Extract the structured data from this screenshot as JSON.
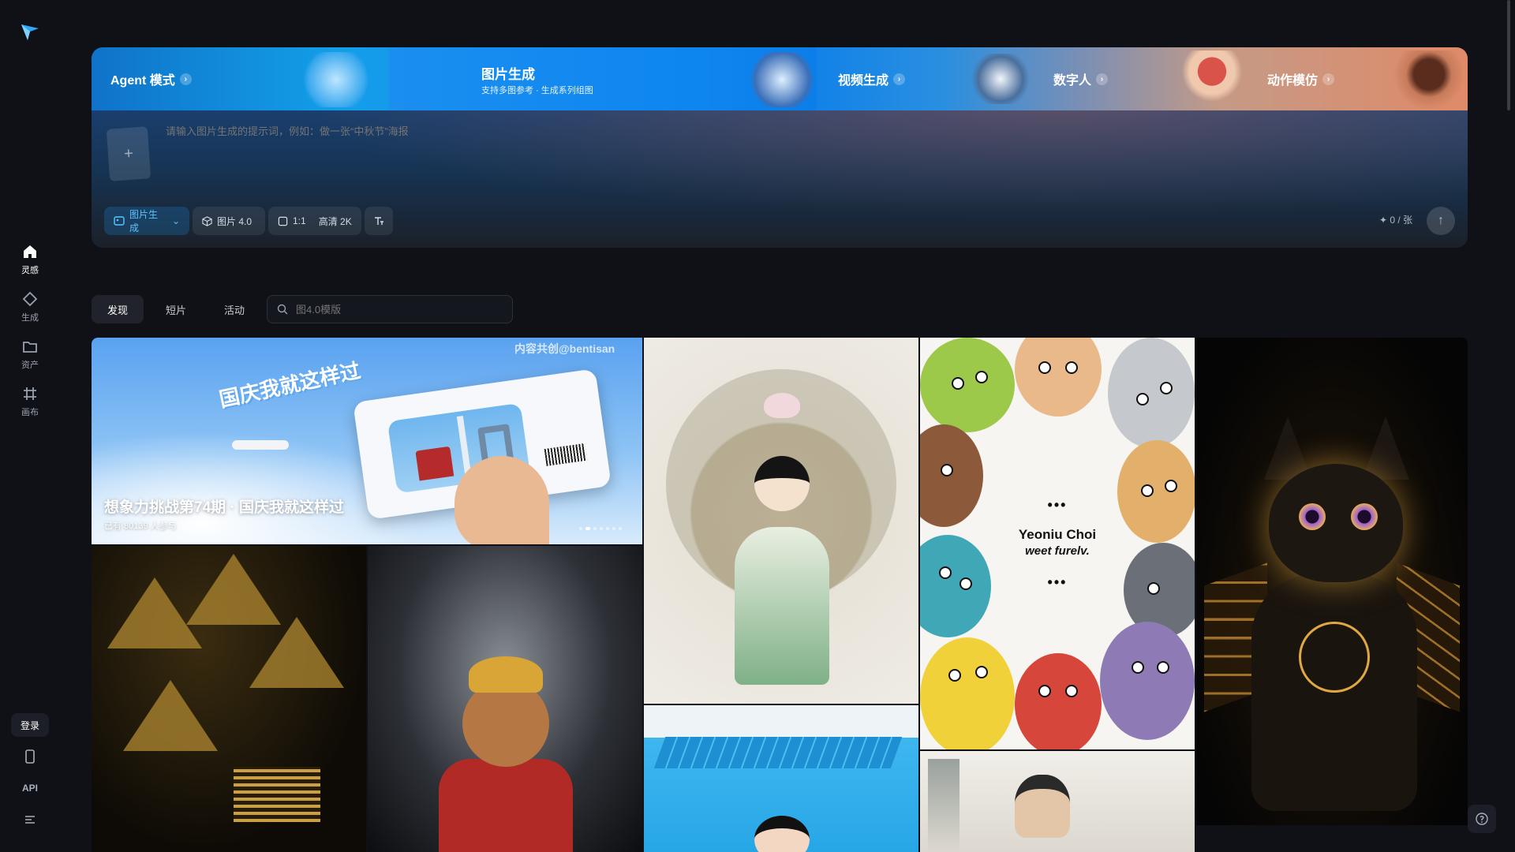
{
  "sidebar": {
    "nav": [
      {
        "label": "灵感",
        "icon": "home-icon"
      },
      {
        "label": "生成",
        "icon": "diamond-icon"
      },
      {
        "label": "资产",
        "icon": "folder-icon"
      },
      {
        "label": "画布",
        "icon": "canvas-icon"
      }
    ],
    "login_label": "登录",
    "api_label": "API"
  },
  "banner": {
    "agent_label": "Agent 模式",
    "image_gen_title": "图片生成",
    "image_gen_sub": "支持多图参考 · 生成系列组图",
    "video_label": "视频生成",
    "avatar_label": "数字人",
    "motion_label": "动作模仿"
  },
  "prompt": {
    "placeholder": "请输入图片生成的提示词，例如：做一张“中秋节”海报",
    "mode_label": "图片生成",
    "model_label": "图片 4.0",
    "ratio_label": "1:1",
    "quality_label": "高清 2K",
    "credits": "0 / 张"
  },
  "tabs": [
    "发现",
    "短片",
    "活动"
  ],
  "search": {
    "placeholder": "图4.0模版"
  },
  "gallery": {
    "hero_title": "想象力挑战第74期 · 国庆我就这样过",
    "hero_sub": "已有 80139 人参与",
    "hero_watermark": "内容共创@bentisan",
    "hero_art_text": "国庆我就这样过",
    "monster_text_1": "Yeoniu Choi",
    "monster_text_2": "weet furelv.",
    "monster_ellipsis": "•••"
  },
  "colors": {
    "accent": "#1a8ff0",
    "bg": "#0f1117"
  }
}
